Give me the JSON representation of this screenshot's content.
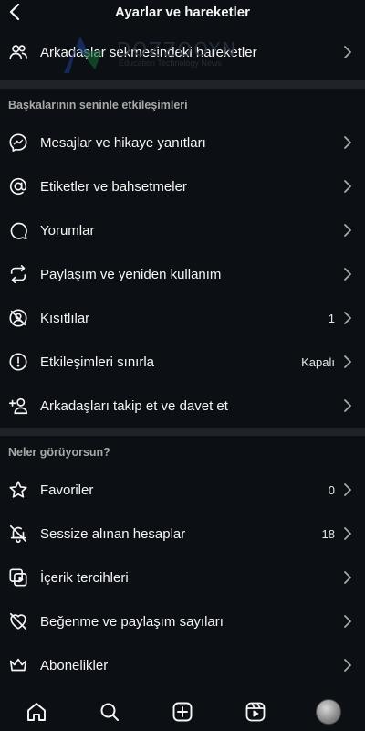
{
  "header": {
    "title": "Ayarlar ve hareketler"
  },
  "top_row": {
    "label": "Arkadaşlar sekmesindeki hareketler"
  },
  "watermark": {
    "text": "DOZZOOYN",
    "sub": "Education Technology News"
  },
  "sections": [
    {
      "title": "Başkalarının seninle etkileşimleri",
      "items": [
        {
          "icon": "messenger-icon",
          "label": "Mesajlar ve hikaye yanıtları",
          "value": ""
        },
        {
          "icon": "at-sign-icon",
          "label": "Etiketler ve bahsetmeler",
          "value": ""
        },
        {
          "icon": "comment-icon",
          "label": "Yorumlar",
          "value": ""
        },
        {
          "icon": "repost-icon",
          "label": "Paylaşım ve yeniden kullanım",
          "value": ""
        },
        {
          "icon": "restricted-icon",
          "label": "Kısıtlılar",
          "value": "1"
        },
        {
          "icon": "alert-circle-icon",
          "label": "Etkileşimleri sınırla",
          "value": "Kapalı"
        },
        {
          "icon": "add-user-icon",
          "label": "Arkadaşları takip et ve davet et",
          "value": ""
        }
      ]
    },
    {
      "title": "Neler görüyorsun?",
      "items": [
        {
          "icon": "star-icon",
          "label": "Favoriler",
          "value": "0"
        },
        {
          "icon": "muted-bell-icon",
          "label": "Sessize alınan hesaplar",
          "value": "18"
        },
        {
          "icon": "content-preferences-icon",
          "label": "İçerik tercihleri",
          "value": ""
        },
        {
          "icon": "hidden-likes-icon",
          "label": "Beğenme ve paylaşım sayıları",
          "value": ""
        },
        {
          "icon": "crown-icon",
          "label": "Abonelikler",
          "value": ""
        }
      ]
    }
  ],
  "tabbar": [
    "home-icon",
    "search-icon",
    "create-icon",
    "reels-icon",
    "profile-avatar"
  ]
}
